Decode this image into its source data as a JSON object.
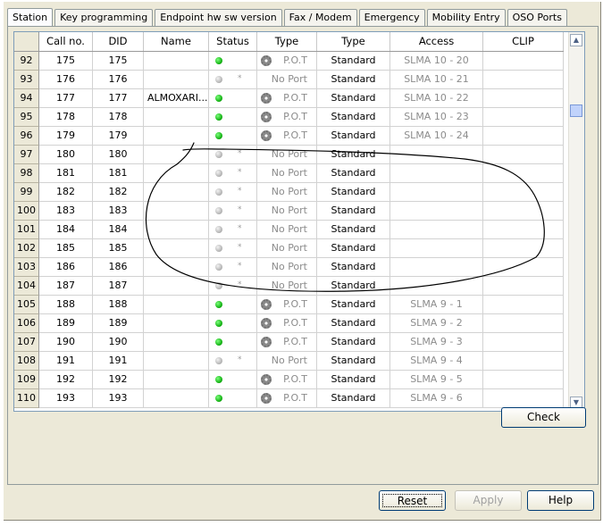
{
  "tabs": [
    {
      "label": "Station",
      "active": true
    },
    {
      "label": "Key programming",
      "active": false
    },
    {
      "label": "Endpoint hw sw version",
      "active": false
    },
    {
      "label": "Fax / Modem",
      "active": false
    },
    {
      "label": "Emergency",
      "active": false
    },
    {
      "label": "Mobility Entry",
      "active": false
    },
    {
      "label": "OSO Ports",
      "active": false
    }
  ],
  "columns": [
    "",
    "Call no.",
    "DID",
    "Name",
    "Status",
    "Type",
    "Type",
    "Access",
    "CLIP"
  ],
  "rows": [
    {
      "num": "92",
      "call": "175",
      "did": "175",
      "name": "",
      "status": "on",
      "port": "P.O.T",
      "type2": "Standard",
      "access": "SLMA  10 - 20",
      "clip": ""
    },
    {
      "num": "93",
      "call": "176",
      "did": "176",
      "name": "",
      "status": "off",
      "port": "No Port",
      "type2": "Standard",
      "access": "SLMA  10 - 21",
      "clip": ""
    },
    {
      "num": "94",
      "call": "177",
      "did": "177",
      "name": "ALMOXARI...",
      "status": "on",
      "port": "P.O.T",
      "type2": "Standard",
      "access": "SLMA  10 - 22",
      "clip": ""
    },
    {
      "num": "95",
      "call": "178",
      "did": "178",
      "name": "",
      "status": "on",
      "port": "P.O.T",
      "type2": "Standard",
      "access": "SLMA  10 - 23",
      "clip": ""
    },
    {
      "num": "96",
      "call": "179",
      "did": "179",
      "name": "",
      "status": "on",
      "port": "P.O.T",
      "type2": "Standard",
      "access": "SLMA  10 - 24",
      "clip": ""
    },
    {
      "num": "97",
      "call": "180",
      "did": "180",
      "name": "",
      "status": "off",
      "port": "No Port",
      "type2": "Standard",
      "access": "",
      "clip": ""
    },
    {
      "num": "98",
      "call": "181",
      "did": "181",
      "name": "",
      "status": "off",
      "port": "No Port",
      "type2": "Standard",
      "access": "",
      "clip": ""
    },
    {
      "num": "99",
      "call": "182",
      "did": "182",
      "name": "",
      "status": "off",
      "port": "No Port",
      "type2": "Standard",
      "access": "",
      "clip": ""
    },
    {
      "num": "100",
      "call": "183",
      "did": "183",
      "name": "",
      "status": "off",
      "port": "No Port",
      "type2": "Standard",
      "access": "",
      "clip": ""
    },
    {
      "num": "101",
      "call": "184",
      "did": "184",
      "name": "",
      "status": "off",
      "port": "No Port",
      "type2": "Standard",
      "access": "",
      "clip": ""
    },
    {
      "num": "102",
      "call": "185",
      "did": "185",
      "name": "",
      "status": "off",
      "port": "No Port",
      "type2": "Standard",
      "access": "",
      "clip": ""
    },
    {
      "num": "103",
      "call": "186",
      "did": "186",
      "name": "",
      "status": "off",
      "port": "No Port",
      "type2": "Standard",
      "access": "",
      "clip": ""
    },
    {
      "num": "104",
      "call": "187",
      "did": "187",
      "name": "",
      "status": "off",
      "port": "No Port",
      "type2": "Standard",
      "access": "",
      "clip": ""
    },
    {
      "num": "105",
      "call": "188",
      "did": "188",
      "name": "",
      "status": "on",
      "port": "P.O.T",
      "type2": "Standard",
      "access": "SLMA  9 - 1",
      "clip": ""
    },
    {
      "num": "106",
      "call": "189",
      "did": "189",
      "name": "",
      "status": "on",
      "port": "P.O.T",
      "type2": "Standard",
      "access": "SLMA  9 - 2",
      "clip": ""
    },
    {
      "num": "107",
      "call": "190",
      "did": "190",
      "name": "",
      "status": "on",
      "port": "P.O.T",
      "type2": "Standard",
      "access": "SLMA  9 - 3",
      "clip": ""
    },
    {
      "num": "108",
      "call": "191",
      "did": "191",
      "name": "",
      "status": "off",
      "port": "No Port",
      "type2": "Standard",
      "access": "SLMA  9 - 4",
      "clip": ""
    },
    {
      "num": "109",
      "call": "192",
      "did": "192",
      "name": "",
      "status": "on",
      "port": "P.O.T",
      "type2": "Standard",
      "access": "SLMA  9 - 5",
      "clip": ""
    },
    {
      "num": "110",
      "call": "193",
      "did": "193",
      "name": "",
      "status": "on",
      "port": "P.O.T",
      "type2": "Standard",
      "access": "SLMA  9 - 6",
      "clip": ""
    }
  ],
  "buttons": {
    "check": "Check",
    "reset": "Reset",
    "apply": "Apply",
    "help": "Help"
  },
  "colors": {
    "status_on": "#12b012",
    "status_off": "#b5b5b5",
    "annotation_ink": "#000000"
  }
}
